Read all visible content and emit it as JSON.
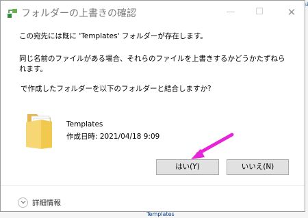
{
  "dialog": {
    "title": "フォルダーの上書きの確認",
    "message_line1": "この宛先には既に 'Templates' フォルダーが存在します。",
    "message_line2": "同じ名前のファイルがある場合、それらのファイルを上書きするかどうかたずねられます。",
    "message_line3": " で作成したフォルダーを以下のフォルダーと結合しますか?",
    "item": {
      "name": "Templates",
      "date_label": "作成日時: 2021/04/18 9:09"
    },
    "buttons": {
      "yes": "はい(Y)",
      "no": "いいえ(N)"
    },
    "details_label": "詳細情報"
  },
  "background": {
    "right_snippet": "Desi",
    "bottom_snippet": "Templates"
  },
  "colors": {
    "annotation_arrow": "#e824d8",
    "folder": "#f6d774"
  }
}
